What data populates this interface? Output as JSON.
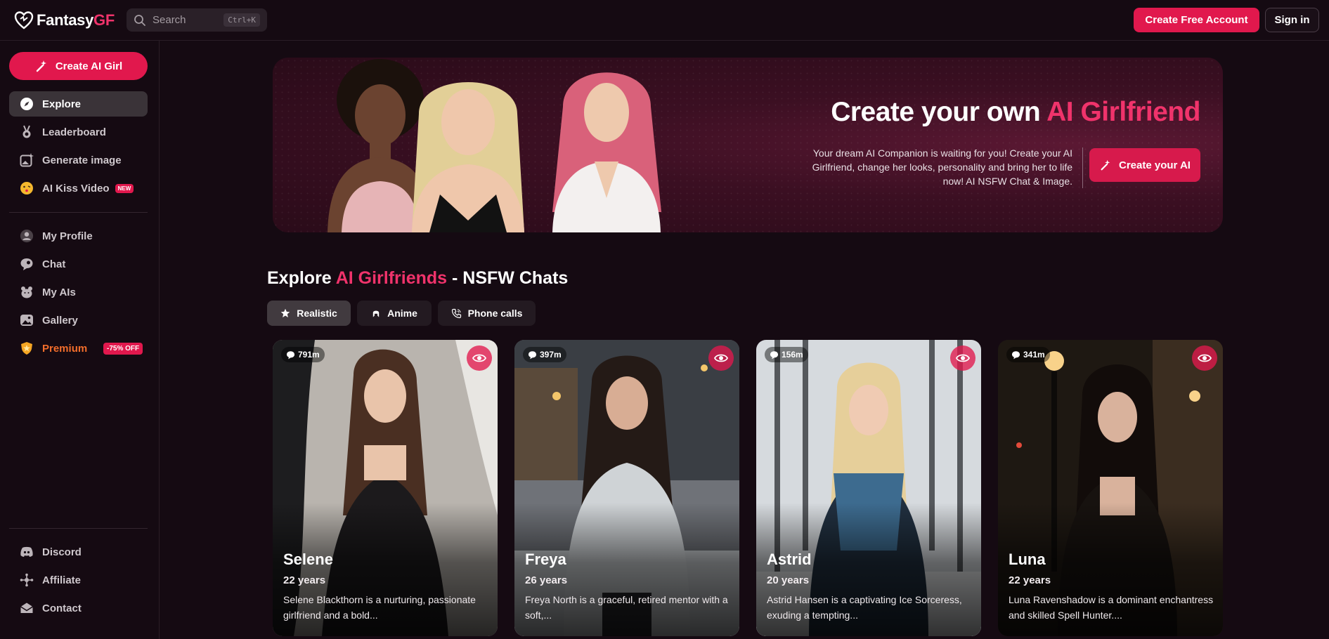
{
  "header": {
    "logo_prefix": "Fantasy",
    "logo_suffix": "GF",
    "search_placeholder": "Search",
    "search_shortcut": "Ctrl+K",
    "create_account_label": "Create Free Account",
    "signin_label": "Sign in"
  },
  "sidebar": {
    "create_ai_label": "Create AI Girl",
    "primary": [
      {
        "label": "Explore",
        "icon": "compass-icon"
      },
      {
        "label": "Leaderboard",
        "icon": "medal-icon"
      },
      {
        "label": "Generate image",
        "icon": "image-sparkle-icon"
      },
      {
        "label": "AI Kiss Video",
        "icon": "kiss-face-icon",
        "badge": "NEW"
      }
    ],
    "secondary": [
      {
        "label": "My Profile",
        "icon": "user-icon"
      },
      {
        "label": "Chat",
        "icon": "chat-icon"
      },
      {
        "label": "My AIs",
        "icon": "bear-icon"
      },
      {
        "label": "Gallery",
        "icon": "gallery-icon"
      },
      {
        "label": "Premium",
        "icon": "shield-icon",
        "badge": "-75% OFF"
      }
    ],
    "footer": [
      {
        "label": "Discord",
        "icon": "discord-icon"
      },
      {
        "label": "Affiliate",
        "icon": "affiliate-icon"
      },
      {
        "label": "Contact",
        "icon": "mail-icon"
      }
    ]
  },
  "hero": {
    "title_prefix": "Create your own ",
    "title_accent": "AI Girlfriend",
    "description": "Your dream AI Companion is waiting for you! Create your AI Girlfriend, change her looks, personality and bring her to life now! AI NSFW Chat & Image.",
    "button_label": "Create your AI"
  },
  "explore": {
    "title_prefix": "Explore ",
    "title_accent": "AI Girlfriends",
    "title_suffix": " - NSFW Chats",
    "tabs": [
      {
        "label": "Realistic",
        "icon": "star-icon"
      },
      {
        "label": "Anime",
        "icon": "anime-icon"
      },
      {
        "label": "Phone calls",
        "icon": "phone-icon"
      }
    ]
  },
  "cards": [
    {
      "name": "Selene",
      "age": "22 years",
      "views": "791m",
      "description": "Selene Blackthorn is a nurturing, passionate girlfriend and a bold..."
    },
    {
      "name": "Freya",
      "age": "26 years",
      "views": "397m",
      "description": "Freya North is a graceful, retired mentor with a soft,..."
    },
    {
      "name": "Astrid",
      "age": "20 years",
      "views": "156m",
      "description": "Astrid Hansen is a captivating Ice Sorceress, exuding a tempting..."
    },
    {
      "name": "Luna",
      "age": "22 years",
      "views": "341m",
      "description": "Luna Ravenshadow is a dominant enchantress and skilled Spell Hunter...."
    }
  ],
  "watermark": "FantasyGF",
  "colors": {
    "accent": "#e1184d",
    "background": "#150a12",
    "premium": "#f26d2b"
  }
}
